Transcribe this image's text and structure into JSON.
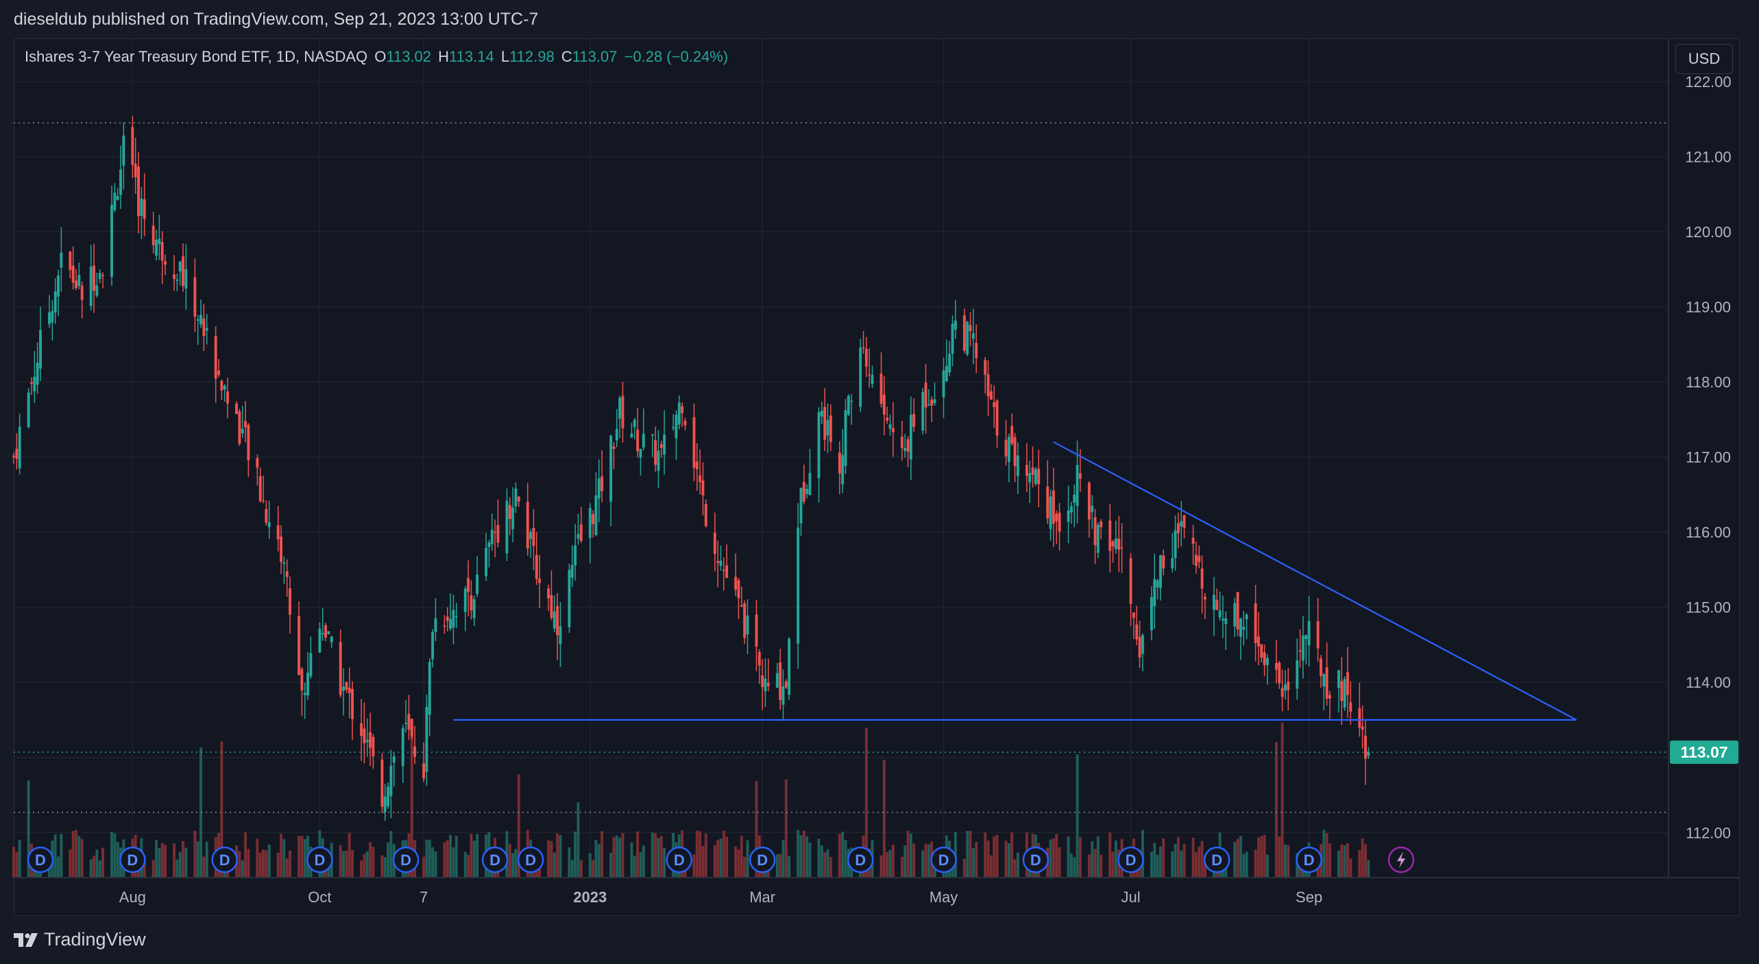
{
  "publisher_line": "dieseldub published on TradingView.com, Sep 21, 2023 13:00 UTC-7",
  "footer": {
    "brand": "TradingView"
  },
  "currency_button": "USD",
  "legend": {
    "symbol": "Ishares 3-7 Year Treasury Bond ETF, 1D, NASDAQ",
    "o_label": "O",
    "o_value": "113.02",
    "h_label": "H",
    "h_value": "113.14",
    "l_label": "L",
    "l_value": "112.98",
    "c_label": "C",
    "c_value": "113.07",
    "change": "−0.28 (−0.24%)"
  },
  "colors": {
    "up": "#26a69a",
    "down": "#ef5350",
    "trendline": "#2962ff",
    "background": "#131722",
    "price_tag": "#22ab94"
  },
  "chart_data": {
    "type": "candlestick",
    "y_axis": {
      "ticks": [
        "122.00",
        "121.00",
        "120.00",
        "119.00",
        "118.00",
        "117.00",
        "116.00",
        "115.00",
        "114.00",
        "113.00",
        "112.00"
      ],
      "range": [
        111.4,
        122.1
      ],
      "position": "right",
      "last_price_label": "113.07",
      "last_price": 113.07
    },
    "x_axis": {
      "ticks": [
        "Aug",
        "Oct",
        "7",
        "2023",
        "Mar",
        "May",
        "Jul",
        "Sep"
      ],
      "bold_ticks": [
        "2023"
      ],
      "range": [
        "2022-06-22",
        "2023-12-31"
      ]
    },
    "grid": true,
    "price_path": [
      [
        "2022-06-22",
        117.0
      ],
      [
        "2022-07-01",
        118.5
      ],
      [
        "2022-07-08",
        119.6
      ],
      [
        "2022-07-15",
        119.2
      ],
      [
        "2022-07-22",
        119.6
      ],
      [
        "2022-07-29",
        121.1
      ],
      [
        "2022-08-03",
        120.4
      ],
      [
        "2022-08-10",
        119.8
      ],
      [
        "2022-08-17",
        119.5
      ],
      [
        "2022-08-24",
        118.8
      ],
      [
        "2022-08-31",
        118.0
      ],
      [
        "2022-09-07",
        117.3
      ],
      [
        "2022-09-14",
        116.4
      ],
      [
        "2022-09-21",
        115.6
      ],
      [
        "2022-09-27",
        113.8
      ],
      [
        "2022-10-03",
        114.9
      ],
      [
        "2022-10-10",
        114.0
      ],
      [
        "2022-10-17",
        113.4
      ],
      [
        "2022-10-24",
        112.5
      ],
      [
        "2022-10-31",
        113.4
      ],
      [
        "2022-11-07",
        112.9
      ],
      [
        "2022-11-10",
        114.8
      ],
      [
        "2022-11-17",
        115.0
      ],
      [
        "2022-11-24",
        115.2
      ],
      [
        "2022-12-01",
        116.0
      ],
      [
        "2022-12-08",
        116.5
      ],
      [
        "2022-12-15",
        115.5
      ],
      [
        "2022-12-22",
        114.8
      ],
      [
        "2022-12-29",
        115.8
      ],
      [
        "2023-01-05",
        116.5
      ],
      [
        "2023-01-12",
        117.6
      ],
      [
        "2023-01-19",
        117.2
      ],
      [
        "2023-01-26",
        117.0
      ],
      [
        "2023-02-02",
        117.8
      ],
      [
        "2023-02-09",
        116.4
      ],
      [
        "2023-02-16",
        115.5
      ],
      [
        "2023-02-23",
        114.8
      ],
      [
        "2023-03-02",
        113.9
      ],
      [
        "2023-03-09",
        114.0
      ],
      [
        "2023-03-13",
        116.2
      ],
      [
        "2023-03-20",
        117.6
      ],
      [
        "2023-03-27",
        117.0
      ],
      [
        "2023-04-03",
        118.5
      ],
      [
        "2023-04-10",
        117.7
      ],
      [
        "2023-04-17",
        117.0
      ],
      [
        "2023-04-24",
        117.8
      ],
      [
        "2023-05-01",
        118.0
      ],
      [
        "2023-05-04",
        118.8
      ],
      [
        "2023-05-11",
        118.5
      ],
      [
        "2023-05-18",
        117.5
      ],
      [
        "2023-05-25",
        117.0
      ],
      [
        "2023-06-01",
        116.8
      ],
      [
        "2023-06-08",
        116.1
      ],
      [
        "2023-06-15",
        116.7
      ],
      [
        "2023-06-22",
        115.9
      ],
      [
        "2023-06-29",
        115.8
      ],
      [
        "2023-07-06",
        114.5
      ],
      [
        "2023-07-13",
        115.6
      ],
      [
        "2023-07-20",
        116.0
      ],
      [
        "2023-07-27",
        115.4
      ],
      [
        "2023-08-03",
        114.9
      ],
      [
        "2023-08-10",
        114.9
      ],
      [
        "2023-08-17",
        114.4
      ],
      [
        "2023-08-24",
        113.9
      ],
      [
        "2023-08-31",
        114.7
      ],
      [
        "2023-09-07",
        114.0
      ],
      [
        "2023-09-14",
        113.9
      ],
      [
        "2023-09-21",
        113.07
      ]
    ],
    "horizontal_levels": [
      121.45,
      112.27,
      113.07
    ],
    "trendlines": [
      {
        "from": [
          "2022-11-17",
          113.5
        ],
        "to": [
          "2023-11-30",
          113.5
        ]
      },
      {
        "from": [
          "2023-06-07",
          117.2
        ],
        "to": [
          "2023-11-30",
          113.5
        ]
      }
    ],
    "dividend_markers": [
      "2022-07-01",
      "2022-08-01",
      "2022-09-01",
      "2022-10-03",
      "2022-11-01",
      "2022-12-01",
      "2022-12-13",
      "2023-02-01",
      "2023-03-01",
      "2023-04-03",
      "2023-05-01",
      "2023-06-01",
      "2023-07-03",
      "2023-08-01",
      "2023-09-01"
    ],
    "dividend_label": "D",
    "earnings_marker": {
      "date": "2023-10-02",
      "icon": "lightning-icon"
    }
  }
}
